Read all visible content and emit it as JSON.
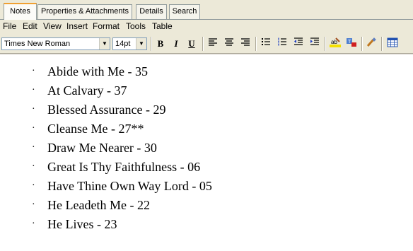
{
  "tabs": [
    "Notes",
    "Properties & Attachments",
    "Details",
    "Search"
  ],
  "menu": [
    "File",
    "Edit",
    "View",
    "Insert",
    "Format",
    "Tools",
    "Table"
  ],
  "toolbar": {
    "font_name": "Times New Roman",
    "font_size": "14pt",
    "bold": "B",
    "italic": "I",
    "underline": "U"
  },
  "list_items": [
    "Abide with Me - 35",
    "At Calvary - 37",
    "Blessed Assurance - 29",
    "Cleanse Me - 27**",
    "Draw Me Nearer - 30",
    "Great Is Thy Faithfulness - 06",
    "Have Thine Own Way Lord - 05",
    "He Leadeth Me - 22",
    "He Lives - 23"
  ],
  "bullet": "·",
  "colors": {
    "active_tab_accent": "#f0a032",
    "chrome": "#ece9d8"
  }
}
